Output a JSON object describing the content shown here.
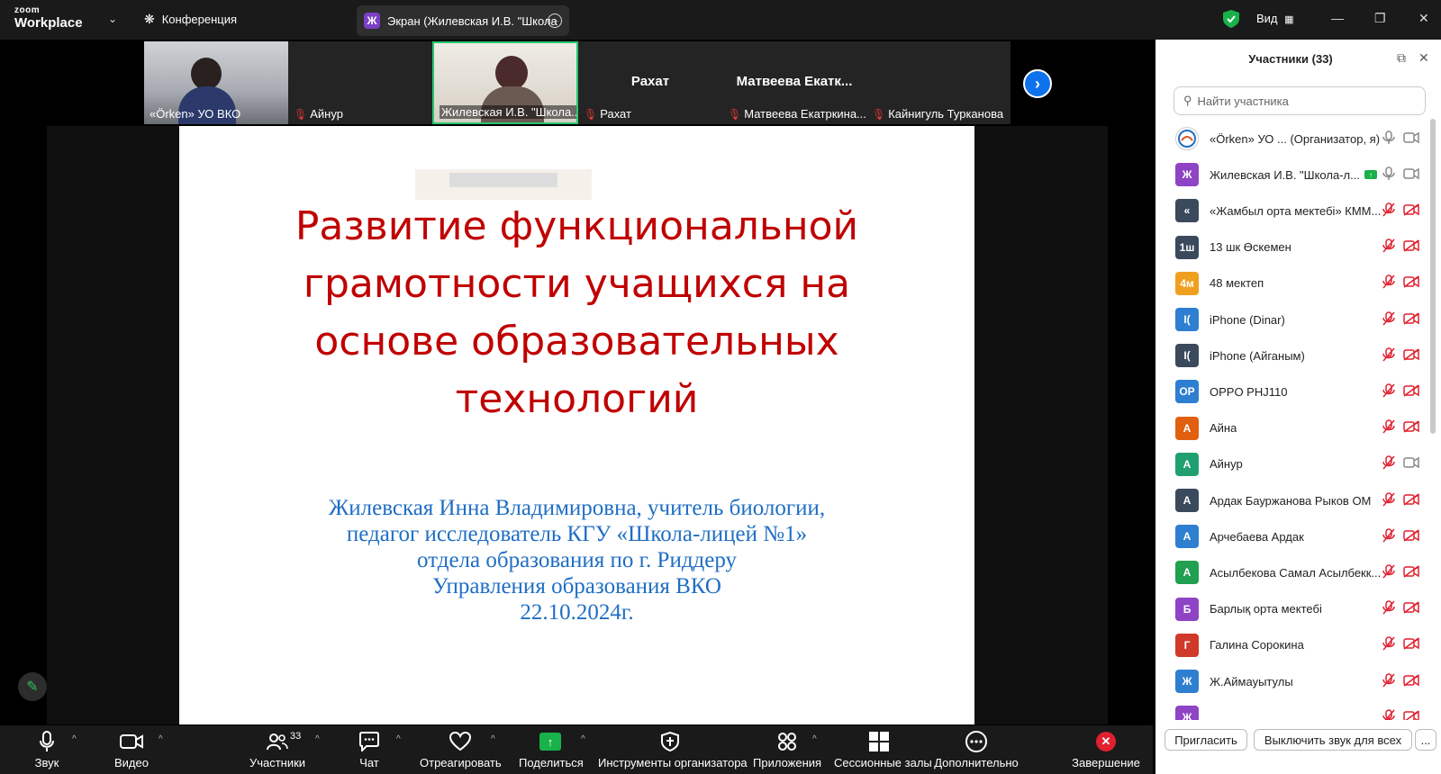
{
  "app": {
    "logo_top": "zoom",
    "logo_bottom": "Workplace",
    "meeting_label": "Конференция",
    "screen_tab_badge": "Ж",
    "screen_tab_label": "Экран (Жилевская И.В. \"Школа",
    "view_label": "Вид"
  },
  "thumbnails": [
    {
      "name": "«Örken» УО ВКО",
      "has_video": true,
      "muted": false
    },
    {
      "name": "Айнур",
      "has_video": false,
      "muted": true
    },
    {
      "name": "Жилевская И.В. \"Школа...",
      "has_video": true,
      "muted": false,
      "active": true
    },
    {
      "name": "Рахат",
      "big_name": "Рахат",
      "has_video": false,
      "muted": true
    },
    {
      "name": "Матвеева Екатркина...",
      "big_name": "Матвеева  Екатк...",
      "has_video": false,
      "muted": true
    },
    {
      "name": "Кайнигуль Турканова",
      "has_video": false,
      "muted": true
    }
  ],
  "slide": {
    "title_lines": [
      "Развитие функциональной",
      "грамотности учащихся на",
      "основе образовательных",
      "технологий"
    ],
    "author_lines": [
      "Жилевская Инна Владимировна, учитель биологии,",
      "педагог исследователь КГУ «Школа-лицей №1»",
      "отдела образования по г. Риддеру",
      "Управления образования ВКО",
      "22.10.2024г."
    ]
  },
  "toolbar": {
    "audio": "Звук",
    "video": "Видео",
    "participants": "Участники",
    "participants_count": "33",
    "chat": "Чат",
    "react": "Отреагировать",
    "share": "Поделиться",
    "host_tools": "Инструменты организатора",
    "apps": "Приложения",
    "breakout": "Сессионные залы",
    "more": "Дополнительно",
    "end": "Завершение"
  },
  "panel": {
    "title": "Участники (33)",
    "search_placeholder": "Найти участника",
    "invite": "Пригласить",
    "mute_all": "Выключить звук для всех",
    "more": "...",
    "participants": [
      {
        "avatar": "",
        "color": "#ffffff",
        "name": "«Örken» УО ...  (Организатор, я)",
        "mic": "on",
        "cam": "on",
        "logo": true
      },
      {
        "avatar": "Ж",
        "color": "#8e44c4",
        "name": "Жилевская И.В. \"Школа-л...",
        "mic": "on",
        "cam": "on",
        "sharing": true
      },
      {
        "avatar": "«",
        "color": "#3a4a5c",
        "name": "«Жамбыл орта мектебі» КММ...",
        "mic": "off",
        "cam": "off"
      },
      {
        "avatar": "1ш",
        "color": "#3a4a5c",
        "name": "13 шк Өскемен",
        "mic": "off",
        "cam": "off"
      },
      {
        "avatar": "4м",
        "color": "#f0a020",
        "name": "48 мектеп",
        "mic": "off",
        "cam": "off"
      },
      {
        "avatar": "I(",
        "color": "#2f7fd0",
        "name": "iPhone (Dinar)",
        "mic": "off",
        "cam": "off"
      },
      {
        "avatar": "I(",
        "color": "#3a4a5c",
        "name": "iPhone (Айганым)",
        "mic": "off",
        "cam": "off"
      },
      {
        "avatar": "OP",
        "color": "#2f7fd0",
        "name": "OPPO PHJ110",
        "mic": "off",
        "cam": "off"
      },
      {
        "avatar": "А",
        "color": "#e06010",
        "name": "Айна",
        "mic": "off",
        "cam": "off"
      },
      {
        "avatar": "А",
        "color": "#20a070",
        "name": "Айнур",
        "mic": "off",
        "cam": "on"
      },
      {
        "avatar": "А",
        "color": "#3a4a5c",
        "name": "Ардак Бауржанова Рыков ОМ",
        "mic": "off",
        "cam": "off"
      },
      {
        "avatar": "А",
        "color": "#2f7fd0",
        "name": "Арчебаева Ардак",
        "mic": "off",
        "cam": "off"
      },
      {
        "avatar": "А",
        "color": "#20a050",
        "name": "Асылбекова Самал Асылбекк...",
        "mic": "off",
        "cam": "off"
      },
      {
        "avatar": "Б",
        "color": "#8e44c4",
        "name": "Барлық орта мектебі",
        "mic": "off",
        "cam": "off"
      },
      {
        "avatar": "Г",
        "color": "#d03a2a",
        "name": "Галина Сорокина",
        "mic": "off",
        "cam": "off"
      },
      {
        "avatar": "Ж",
        "color": "#2f7fd0",
        "name": "Ж.Аймауытулы",
        "mic": "off",
        "cam": "off"
      },
      {
        "avatar": "Ж",
        "color": "#8e44c4",
        "name": "",
        "mic": "off",
        "cam": "off"
      }
    ]
  }
}
